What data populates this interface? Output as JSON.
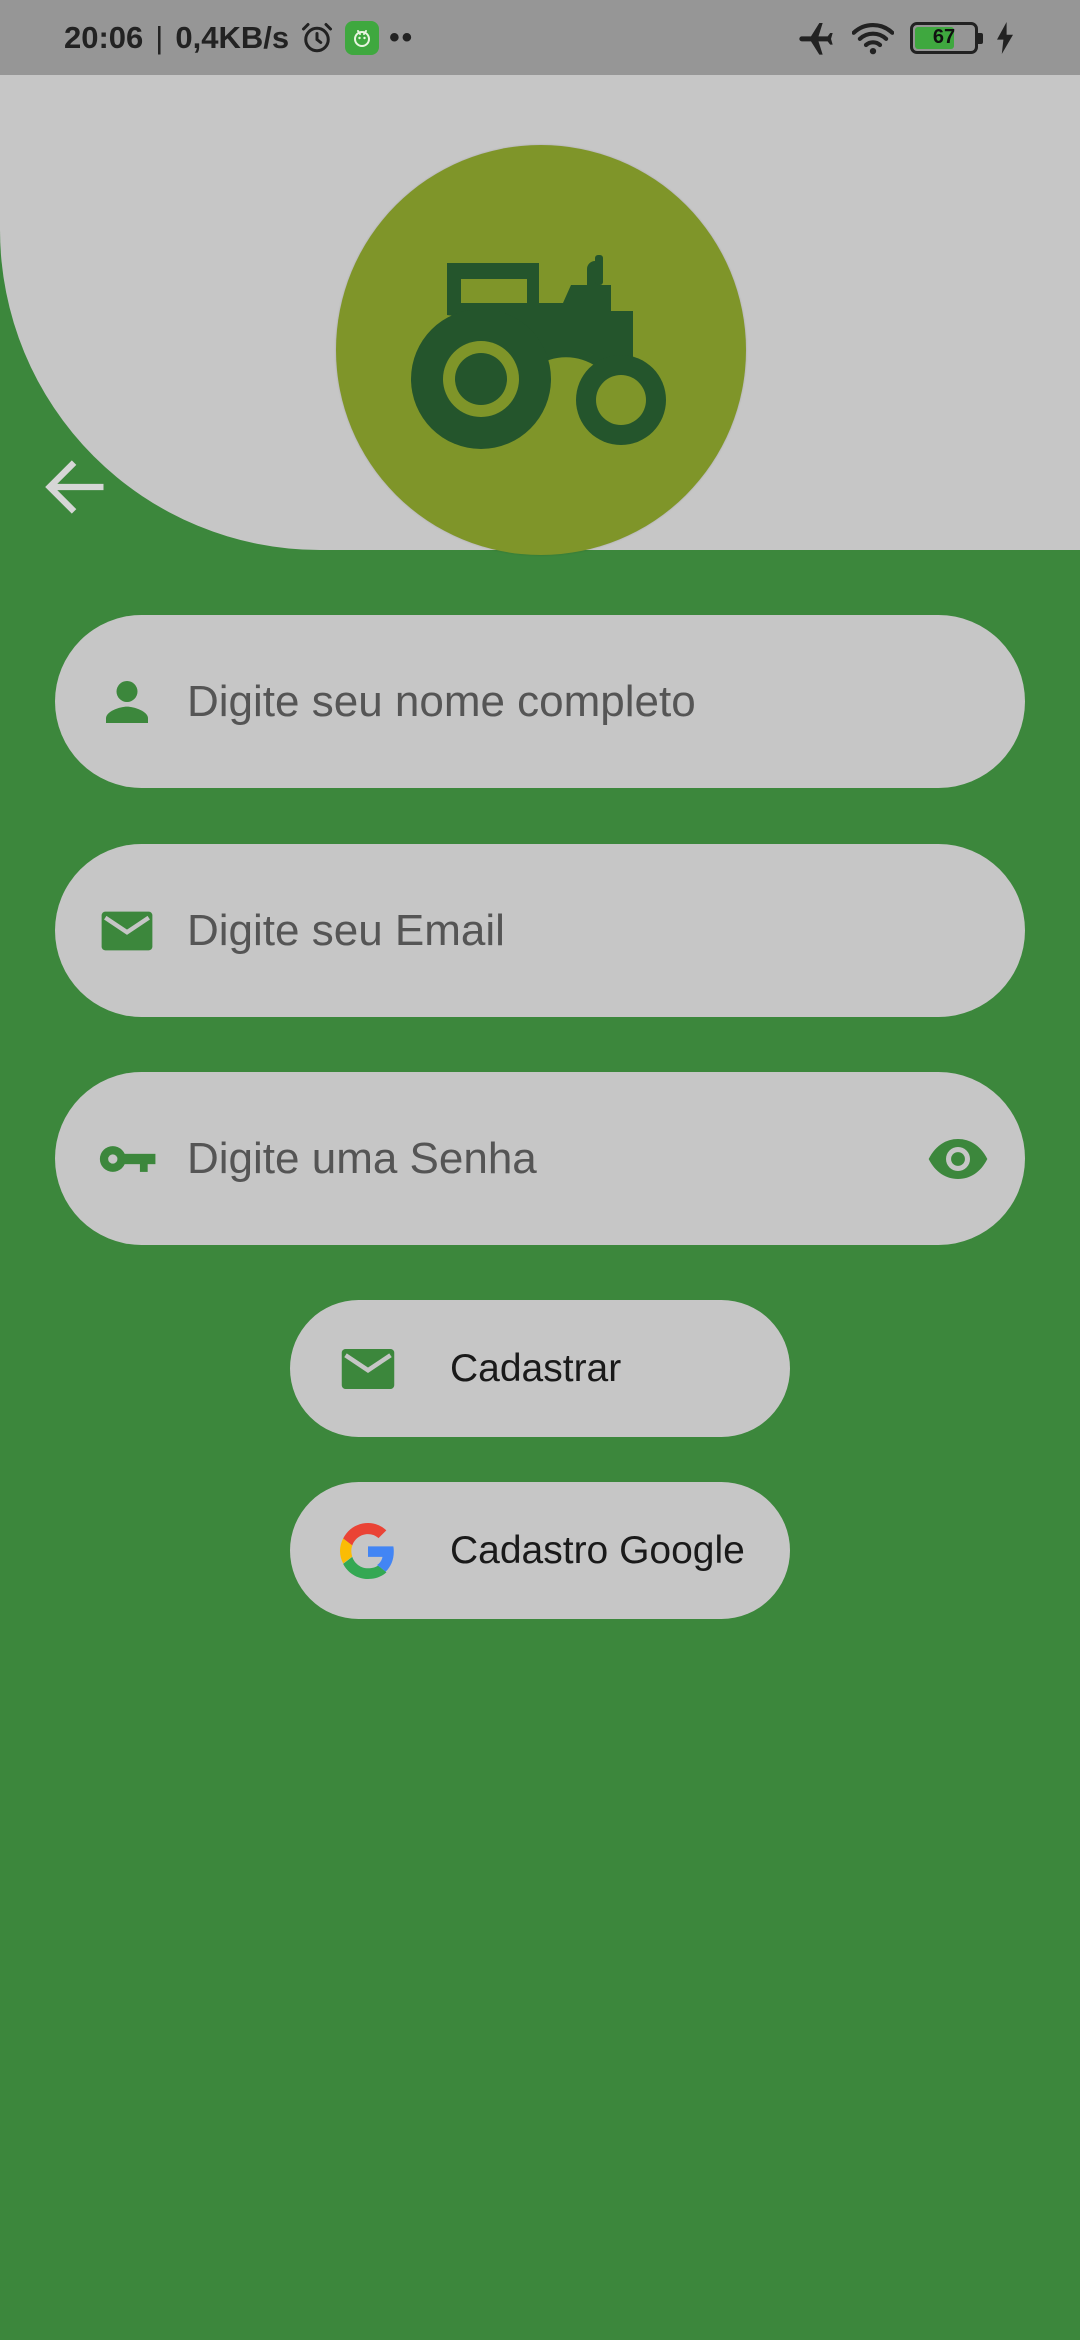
{
  "status_bar": {
    "time": "20:06",
    "separator": "|",
    "speed": "0,4KB/s",
    "dots": "••",
    "battery_level": "67",
    "battery_fraction": 0.67
  },
  "colors": {
    "background": "#3c873c",
    "header": "#c6c6c6",
    "logo_circle": "#7f9529",
    "tractor": "#24552c",
    "field_icon": "#3c873c"
  },
  "icons": {
    "back": "arrow-left-icon",
    "logo": "tractor-icon",
    "name": "person-icon",
    "email": "mail-icon",
    "password": "key-icon",
    "visibility": "eye-icon",
    "register": "mail-icon",
    "google": "google-icon"
  },
  "form": {
    "name_placeholder": "Digite seu nome completo",
    "email_placeholder": "Digite seu Email",
    "password_placeholder": "Digite uma Senha"
  },
  "buttons": {
    "register_label": "Cadastrar",
    "google_label": "Cadastro Google"
  }
}
